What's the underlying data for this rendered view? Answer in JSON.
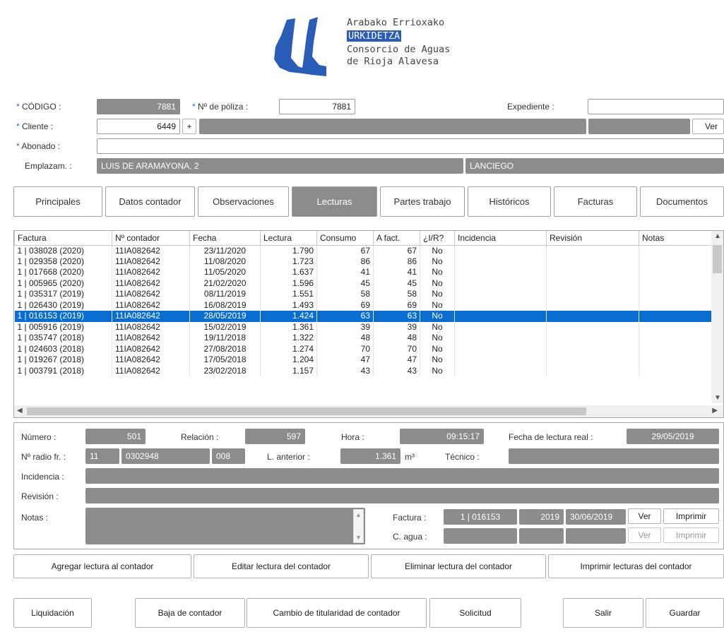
{
  "logo": {
    "line1": "Arabako Errioxako",
    "line2": "URKIDETZA",
    "line3": "Consorcio de Aguas",
    "line4": "de Rioja Alavesa",
    "brand_color": "#2a5db7"
  },
  "header": {
    "codigo_label": "CÓDIGO :",
    "codigo_value": "7881",
    "poliza_label": "Nº de póliza :",
    "poliza_value": "7881",
    "expediente_label": "Expediente :",
    "expediente_value": "",
    "cliente_label": "Cliente :",
    "cliente_value": "6449",
    "cliente_add": "+",
    "ver_label": "Ver",
    "abonado_label": "Abonado :",
    "abonado_value": "",
    "emplazam_label": "Emplazam. :",
    "emplazam_value": "LUIS DE ARAMAYONA, 2",
    "emplazam_town": "LANCIEGO",
    "required_mark": "*"
  },
  "tabs": [
    "Principales",
    "Datos contador",
    "Observaciones",
    "Lecturas",
    "Partes trabajo",
    "Históricos",
    "Facturas",
    "Documentos"
  ],
  "active_tab": "Lecturas",
  "table": {
    "columns": [
      "Factura",
      "Nº contador",
      "Fecha",
      "Lectura",
      "Consumo",
      "A fact.",
      "¿I/R?",
      "Incidencia",
      "Revisión",
      "Notas"
    ],
    "rows": [
      [
        "1 | 038028 (2020)",
        "11IA082642",
        "23/11/2020",
        "1.790",
        "67",
        "67",
        "No",
        "",
        "",
        ""
      ],
      [
        "1 | 029358 (2020)",
        "11IA082642",
        "11/08/2020",
        "1.723",
        "86",
        "86",
        "No",
        "",
        "",
        ""
      ],
      [
        "1 | 017668 (2020)",
        "11IA082642",
        "11/05/2020",
        "1.637",
        "41",
        "41",
        "No",
        "",
        "",
        ""
      ],
      [
        "1 | 005965 (2020)",
        "11IA082642",
        "21/02/2020",
        "1.596",
        "45",
        "45",
        "No",
        "",
        "",
        ""
      ],
      [
        "1 | 035317 (2019)",
        "11IA082642",
        "08/11/2019",
        "1.551",
        "58",
        "58",
        "No",
        "",
        "",
        ""
      ],
      [
        "1 | 026430 (2019)",
        "11IA082642",
        "16/08/2019",
        "1.493",
        "69",
        "69",
        "No",
        "",
        "",
        ""
      ],
      [
        "1 | 016153 (2019)",
        "11IA082642",
        "28/05/2019",
        "1.424",
        "63",
        "63",
        "No",
        "",
        "",
        ""
      ],
      [
        "1 | 005916 (2019)",
        "11IA082642",
        "15/02/2019",
        "1.361",
        "39",
        "39",
        "No",
        "",
        "",
        ""
      ],
      [
        "1 | 035747 (2018)",
        "11IA082642",
        "19/11/2018",
        "1.322",
        "48",
        "48",
        "No",
        "",
        "",
        ""
      ],
      [
        "1 | 024603 (2018)",
        "11IA082642",
        "27/08/2018",
        "1.274",
        "70",
        "70",
        "No",
        "",
        "",
        ""
      ],
      [
        "1 | 019267 (2018)",
        "11IA082642",
        "17/05/2018",
        "1.204",
        "47",
        "47",
        "No",
        "",
        "",
        ""
      ],
      [
        "1 | 003791 (2018)",
        "11IA082642",
        "23/02/2018",
        "1.157",
        "43",
        "43",
        "No",
        "",
        "",
        ""
      ]
    ],
    "selected_row": 6,
    "selection_color": "#0a6dd1"
  },
  "detail": {
    "numero_label": "Número :",
    "numero_value": "501",
    "relacion_label": "Relación :",
    "relacion_value": "597",
    "hora_label": "Hora :",
    "hora_value": "09:15:17",
    "fecha_real_label": "Fecha de lectura real :",
    "fecha_real_value": "29/05/2019",
    "radio_label": "Nº radio fr. :",
    "radio_a": "11",
    "radio_b": "0302948",
    "radio_c": "008",
    "anterior_label": "L. anterior :",
    "anterior_value": "1.361",
    "anterior_unit": "m³",
    "tecnico_label": "Técnico :",
    "tecnico_value": "",
    "incidencia_label": "Incidencia :",
    "revision_label": "Revisión :",
    "notas_label": "Notas :",
    "factura_label": "Factura :",
    "factura_num": "1 | 016153",
    "factura_year": "2019",
    "factura_date": "30/06/2019",
    "cagua_label": "C. agua :",
    "ver_label": "Ver",
    "imprimir_label": "Imprimir"
  },
  "actions": {
    "agregar": "Agregar lectura al contador",
    "editar": "Editar lectura del contador",
    "eliminar": "Eliminar lectura del contador",
    "imprimir": "Imprimir lecturas del contador"
  },
  "footer": {
    "liquidacion": "Liquidación",
    "baja": "Baja de contador",
    "cambio": "Cambio de titularidad de contador",
    "solicitud": "Solicitud",
    "salir": "Salir",
    "guardar": "Guardar"
  }
}
